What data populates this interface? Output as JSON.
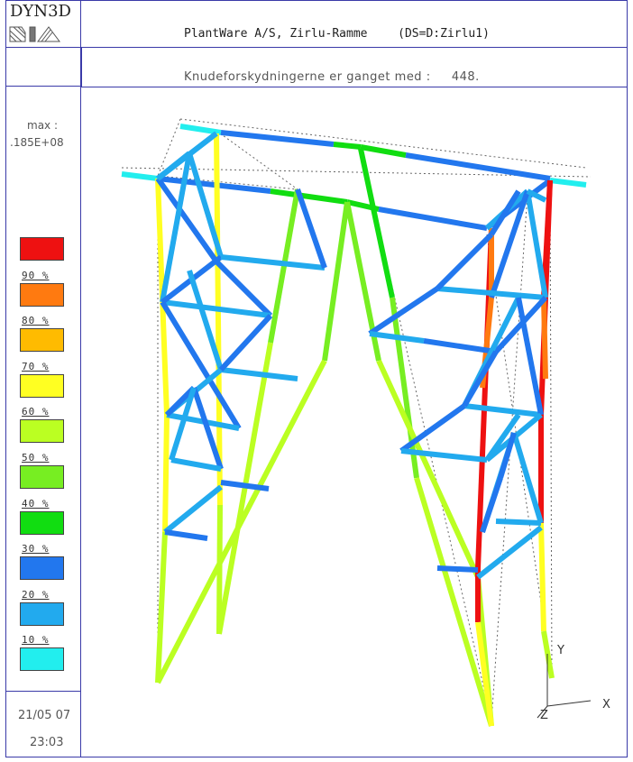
{
  "app": {
    "name": "DYN3D"
  },
  "header": {
    "title": "PlantWare A/S, Zirlu-Ramme",
    "dataset": "(DS=D:Zirlu1)",
    "subtitle_label": "Knudeforskydningerne er ganget med :",
    "subtitle_value": "448."
  },
  "legend": {
    "max_label": "max :",
    "max_value": ".185E+08",
    "levels": [
      {
        "label": "",
        "color": "#ee1111"
      },
      {
        "label": "90 %",
        "color": "#ff7a10"
      },
      {
        "label": "80 %",
        "color": "#ffbb00"
      },
      {
        "label": "70 %",
        "color": "#ffff22"
      },
      {
        "label": "60 %",
        "color": "#bbff22"
      },
      {
        "label": "50 %",
        "color": "#77ee22"
      },
      {
        "label": "40 %",
        "color": "#11dd11"
      },
      {
        "label": "30 %",
        "color": "#2277ee"
      },
      {
        "label": "20 %",
        "color": "#22aaee"
      },
      {
        "label": "10 %",
        "color": "#22eeee"
      }
    ]
  },
  "footer": {
    "date": "21/05 07",
    "time": "23:03"
  },
  "axes": {
    "y": "Y",
    "x": "X",
    "z": "Z"
  }
}
